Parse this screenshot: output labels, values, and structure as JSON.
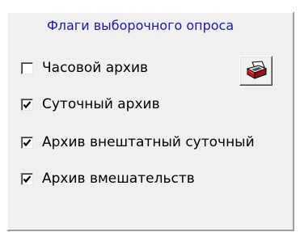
{
  "group": {
    "title": "Флаги выборочного опроса"
  },
  "options": [
    {
      "label": "Часовой архив",
      "checked": false
    },
    {
      "label": "Суточный архив",
      "checked": true
    },
    {
      "label": "Архив внештатный суточный",
      "checked": true
    },
    {
      "label": "Архив вмешательств",
      "checked": true
    }
  ],
  "print_button": {
    "icon": "printer-icon"
  },
  "colors": {
    "title": "#1a1aa6",
    "panel": "#f0f0f0",
    "icon_red": "#c0141e"
  }
}
